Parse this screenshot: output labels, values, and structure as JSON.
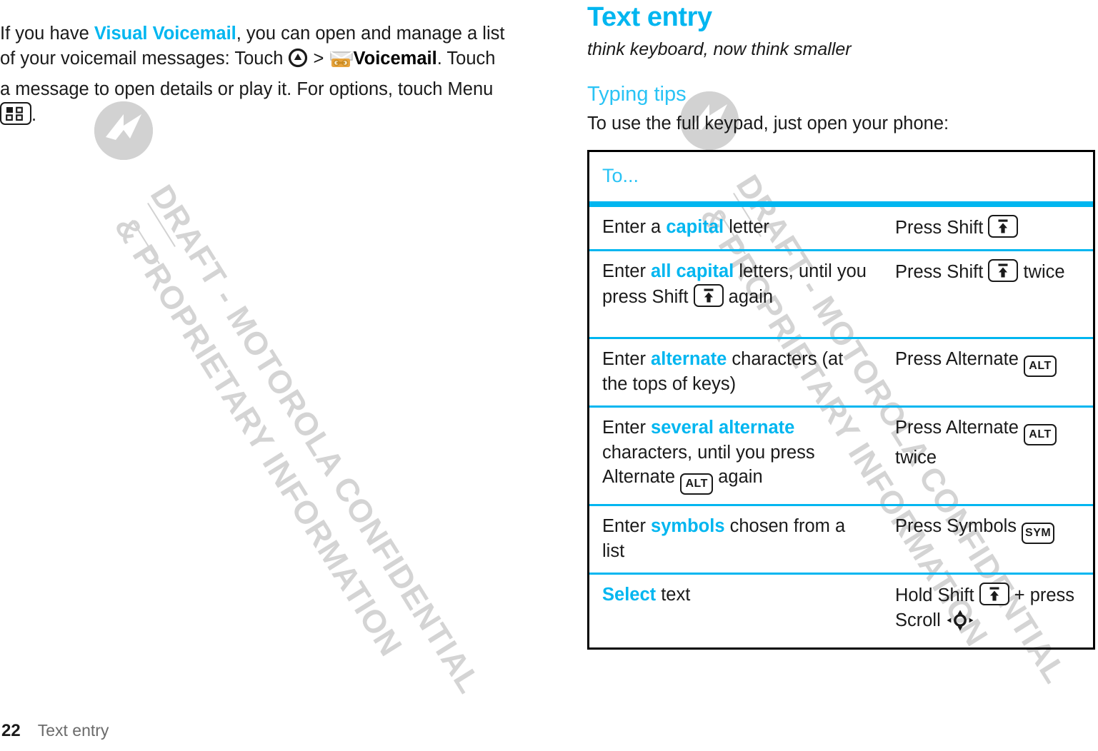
{
  "page": {
    "number": "22",
    "section": "Text entry"
  },
  "watermark": {
    "line1": "DRAFT - MOTOROLA CONFIDENTIAL",
    "line2": "& PROPRIETARY INFORMATION",
    "logo_name": "motorola-batwing-logo",
    "color": "#d4d4d4"
  },
  "left_column": {
    "paragraph": {
      "seg1": "If you have ",
      "highlight1": "Visual Voicemail",
      "seg2": ", you can open and manage a list of your voicemail messages: Touch ",
      "icon1": "touch-up-arrow-icon",
      "seg3": " > ",
      "icon2": "voicemail-envelope-icon",
      "bold1": "Voicemail",
      "seg4": ". Touch a message to open details or play it. For options, touch Menu ",
      "icon3": "menu-grid-icon",
      "seg5": "."
    }
  },
  "right_column": {
    "title": "Text entry",
    "subtitle": "think keyboard, now think smaller",
    "section_heading": "Typing tips",
    "lead": "To use the full keypad, just open your phone:"
  },
  "table": {
    "header": "To...",
    "rows": [
      {
        "to_pre": "Enter a ",
        "to_hl": "capital",
        "to_post": " letter",
        "do_pre": "Press Shift ",
        "do_key": "shift-key-icon",
        "do_post": ""
      },
      {
        "to_pre": "Enter ",
        "to_hl": "all capital",
        "to_post": " letters, until you press Shift ",
        "to_key": "shift-key-icon",
        "to_tail": " again",
        "do_pre": "Press Shift ",
        "do_key": "shift-key-icon",
        "do_post": " twice"
      },
      {
        "to_pre": "Enter ",
        "to_hl": "alternate",
        "to_post": " characters (at the tops of keys)",
        "do_pre": "Press Alternate ",
        "do_key": "alt-key-icon",
        "do_key_label": "ALT",
        "do_post": ""
      },
      {
        "to_pre": "Enter ",
        "to_hl": "several alternate",
        "to_post": " characters, until you press Alternate ",
        "to_key": "alt-key-icon",
        "to_key_label": "ALT",
        "to_tail": " again",
        "do_pre": "Press Alternate ",
        "do_key": "alt-key-icon",
        "do_key_label": "ALT",
        "do_post": " twice"
      },
      {
        "to_pre": "Enter ",
        "to_hl": "symbols",
        "to_post": " chosen from a list",
        "do_pre": "Press Symbols ",
        "do_key": "sym-key-icon",
        "do_key_label": "SYM",
        "do_post": ""
      },
      {
        "to_hl": "Select",
        "to_post": " text",
        "do_pre": "Hold Shift ",
        "do_key": "shift-key-icon",
        "do_mid": " + press Scroll ",
        "do_key2": "scroll-nav-icon"
      }
    ]
  },
  "colors": {
    "accent_cyan": "#00b6f0",
    "heading_cyan": "#29c3f5",
    "text": "#1a1a1a",
    "watermark_gray": "#d4d4d4",
    "footer_gray": "#6b6b6b"
  }
}
